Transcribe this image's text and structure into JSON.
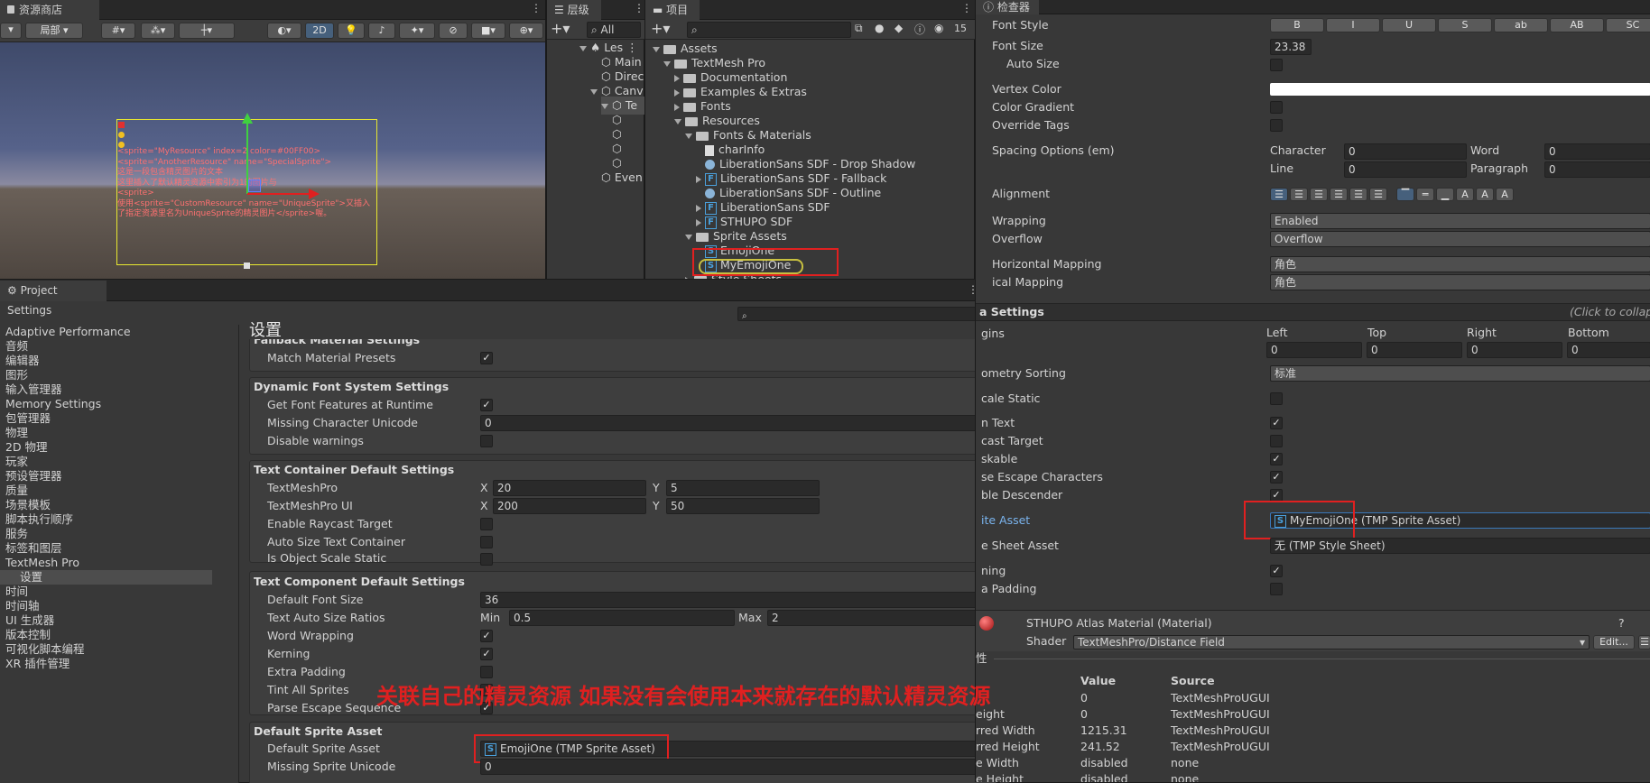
{
  "scene": {
    "tab": "资源商店",
    "toolbar": {
      "local": "局部",
      "mode2d": "2D"
    },
    "lines": [
      "<sprite=\"MyResource\" index=2 color=#00FF00>",
      "<sprite=\"AnotherResource\" name=\"SpecialSprite\">",
      "这是一段包含精灵图片的文本",
      "这里插入了默认精灵资源中索引为1的图片与",
      "<sprite>",
      "使用<sprite=\"CustomResource\" name=\"UniqueSprite\">又插入",
      "了指定资源里名为UniqueSprite的精灵图片</sprite>喔。"
    ]
  },
  "hierarchy": {
    "tab": "层级",
    "search": "All",
    "items": [
      "Les",
      "Main",
      "Direc",
      "Canv",
      "Te",
      "",
      "",
      "",
      "",
      "Even"
    ]
  },
  "project": {
    "tab": "项目",
    "count": "15",
    "tree": [
      {
        "label": "Assets",
        "depth": 0,
        "kind": "folder",
        "open": true
      },
      {
        "label": "TextMesh Pro",
        "depth": 1,
        "kind": "folder",
        "open": true
      },
      {
        "label": "Documentation",
        "depth": 2,
        "kind": "folder",
        "open": false
      },
      {
        "label": "Examples & Extras",
        "depth": 2,
        "kind": "folder",
        "open": false
      },
      {
        "label": "Fonts",
        "depth": 2,
        "kind": "folder",
        "open": false
      },
      {
        "label": "Resources",
        "depth": 2,
        "kind": "folder",
        "open": true
      },
      {
        "label": "Fonts & Materials",
        "depth": 3,
        "kind": "folder",
        "open": true
      },
      {
        "label": "charInfo",
        "depth": 4,
        "kind": "file"
      },
      {
        "label": "LiberationSans SDF - Drop Shadow",
        "depth": 4,
        "kind": "mat"
      },
      {
        "label": "LiberationSans SDF - Fallback",
        "depth": 4,
        "kind": "font",
        "open": false
      },
      {
        "label": "LiberationSans SDF - Outline",
        "depth": 4,
        "kind": "mat"
      },
      {
        "label": "LiberationSans SDF",
        "depth": 4,
        "kind": "font",
        "open": false
      },
      {
        "label": "STHUPO SDF",
        "depth": 4,
        "kind": "font",
        "open": false
      },
      {
        "label": "Sprite Assets",
        "depth": 3,
        "kind": "folder",
        "open": true
      },
      {
        "label": "EmojiOne",
        "depth": 4,
        "kind": "sprite"
      },
      {
        "label": "MyEmojiOne",
        "depth": 4,
        "kind": "sprite"
      },
      {
        "label": "Style Sheets",
        "depth": 3,
        "kind": "folder",
        "open": false
      }
    ]
  },
  "settings": {
    "window_title": "Project Settings",
    "page_title": "设置",
    "nav": [
      "Adaptive Performance",
      "音频",
      "编辑器",
      "图形",
      "输入管理器",
      "Memory Settings",
      "包管理器",
      "物理",
      "2D 物理",
      "玩家",
      "预设管理器",
      "质量",
      "场景模板",
      "脚本执行顺序",
      "服务",
      "标签和图层",
      "TextMesh Pro",
      "设置",
      "时间",
      "时间轴",
      "UI 生成器",
      "版本控制",
      "可视化脚本编程",
      "XR 插件管理"
    ],
    "sections": {
      "fallback": "Fallback Material Settings",
      "match_presets": "Match Material Presets",
      "dynamic": "Dynamic Font System Settings",
      "get_features": "Get Font Features at Runtime",
      "missing_unicode": "Missing Character Unicode",
      "missing_unicode_val": "0",
      "disable_warnings": "Disable warnings",
      "container": "Text Container Default Settings",
      "tmp": "TextMeshPro",
      "tmp_x": "20",
      "tmp_y": "5",
      "tmp_ui": "TextMeshPro UI",
      "tmp_ui_x": "200",
      "tmp_ui_y": "50",
      "raycast": "Enable Raycast Target",
      "autosize": "Auto Size Text Container",
      "objscale": "Is Object Scale Static",
      "component": "Text Component Default Settings",
      "def_font_size": "Default Font Size",
      "def_font_size_val": "36",
      "auto_ratio": "Text Auto Size Ratios",
      "min": "Min",
      "min_val": "0.5",
      "max": "Max",
      "max_val": "2",
      "word_wrap": "Word Wrapping",
      "kerning": "Kerning",
      "extra_pad": "Extra Padding",
      "tint_all": "Tint All Sprites",
      "parse_escape": "Parse Escape Sequence",
      "sprite": "Default Sprite Asset",
      "def_sprite": "Default Sprite Asset",
      "def_sprite_val": "EmojiOne (TMP Sprite Asset)",
      "missing_sprite": "Missing Sprite Unicode",
      "missing_sprite_val": "0",
      "x": "X",
      "y": "Y"
    }
  },
  "annotation": "关联自己的精灵资源 如果没有会使用本来就存在的默认精灵资源",
  "inspector": {
    "tab": "检查器",
    "font_style": "Font Style",
    "style_buttons": [
      "B",
      "I",
      "U",
      "S",
      "ab",
      "AB",
      "SC"
    ],
    "font_size": "Font Size",
    "font_size_val": "23.38",
    "auto_size": "Auto Size",
    "vertex_color": "Vertex Color",
    "color_gradient": "Color Gradient",
    "override_tags": "Override Tags",
    "spacing": "Spacing Options (em)",
    "character": "Character",
    "character_val": "0",
    "word": "Word",
    "word_val": "0",
    "line": "Line",
    "line_val": "0",
    "paragraph": "Paragraph",
    "paragraph_val": "0",
    "alignment": "Alignment",
    "wrapping": "Wrapping",
    "wrapping_val": "Enabled",
    "overflow": "Overflow",
    "overflow_val": "Overflow",
    "hmap": "Horizontal Mapping",
    "hmap_val": "角色",
    "vmap": "ical Mapping",
    "vmap_val": "角色",
    "extra": "a Settings",
    "click_collapse": "(Click to collaps",
    "margins": "gins",
    "left": "Left",
    "top": "Top",
    "right": "Right",
    "bottom": "Bottom",
    "left_val": "0",
    "top_val": "0",
    "right_val": "0",
    "bottom_val": "0",
    "geom": "ometry Sorting",
    "geom_val": "标准",
    "scale_static": "cale Static",
    "rich_text": "n Text",
    "raycast": "cast Target",
    "maskable": "skable",
    "parse_esc": "se Escape Characters",
    "visible_desc": "ble Descender",
    "sprite_asset": "ite Asset",
    "sprite_asset_val": "MyEmojiOne (TMP Sprite Asset)",
    "style_sheet": "e Sheet Asset",
    "style_sheet_val": "无 (TMP Style Sheet)",
    "kerning": "ning",
    "extra_pad": "a Padding",
    "material": "STHUPO Atlas Material (Material)",
    "shader": "Shader",
    "shader_val": "TextMeshPro/Distance Field",
    "edit": "Edit...",
    "prop_hdr": "性",
    "col_value": "Value",
    "col_source": "Source",
    "props": [
      {
        "n": "",
        "v": "0",
        "s": "TextMeshProUGUI"
      },
      {
        "n": "eight",
        "v": "0",
        "s": "TextMeshProUGUI"
      },
      {
        "n": "rred Width",
        "v": "1215.31",
        "s": "TextMeshProUGUI"
      },
      {
        "n": "rred Height",
        "v": "241.52",
        "s": "TextMeshProUGUI"
      },
      {
        "n": "e Width",
        "v": "disabled",
        "s": "none"
      },
      {
        "n": "e Height",
        "v": "disabled",
        "s": "none"
      }
    ]
  }
}
